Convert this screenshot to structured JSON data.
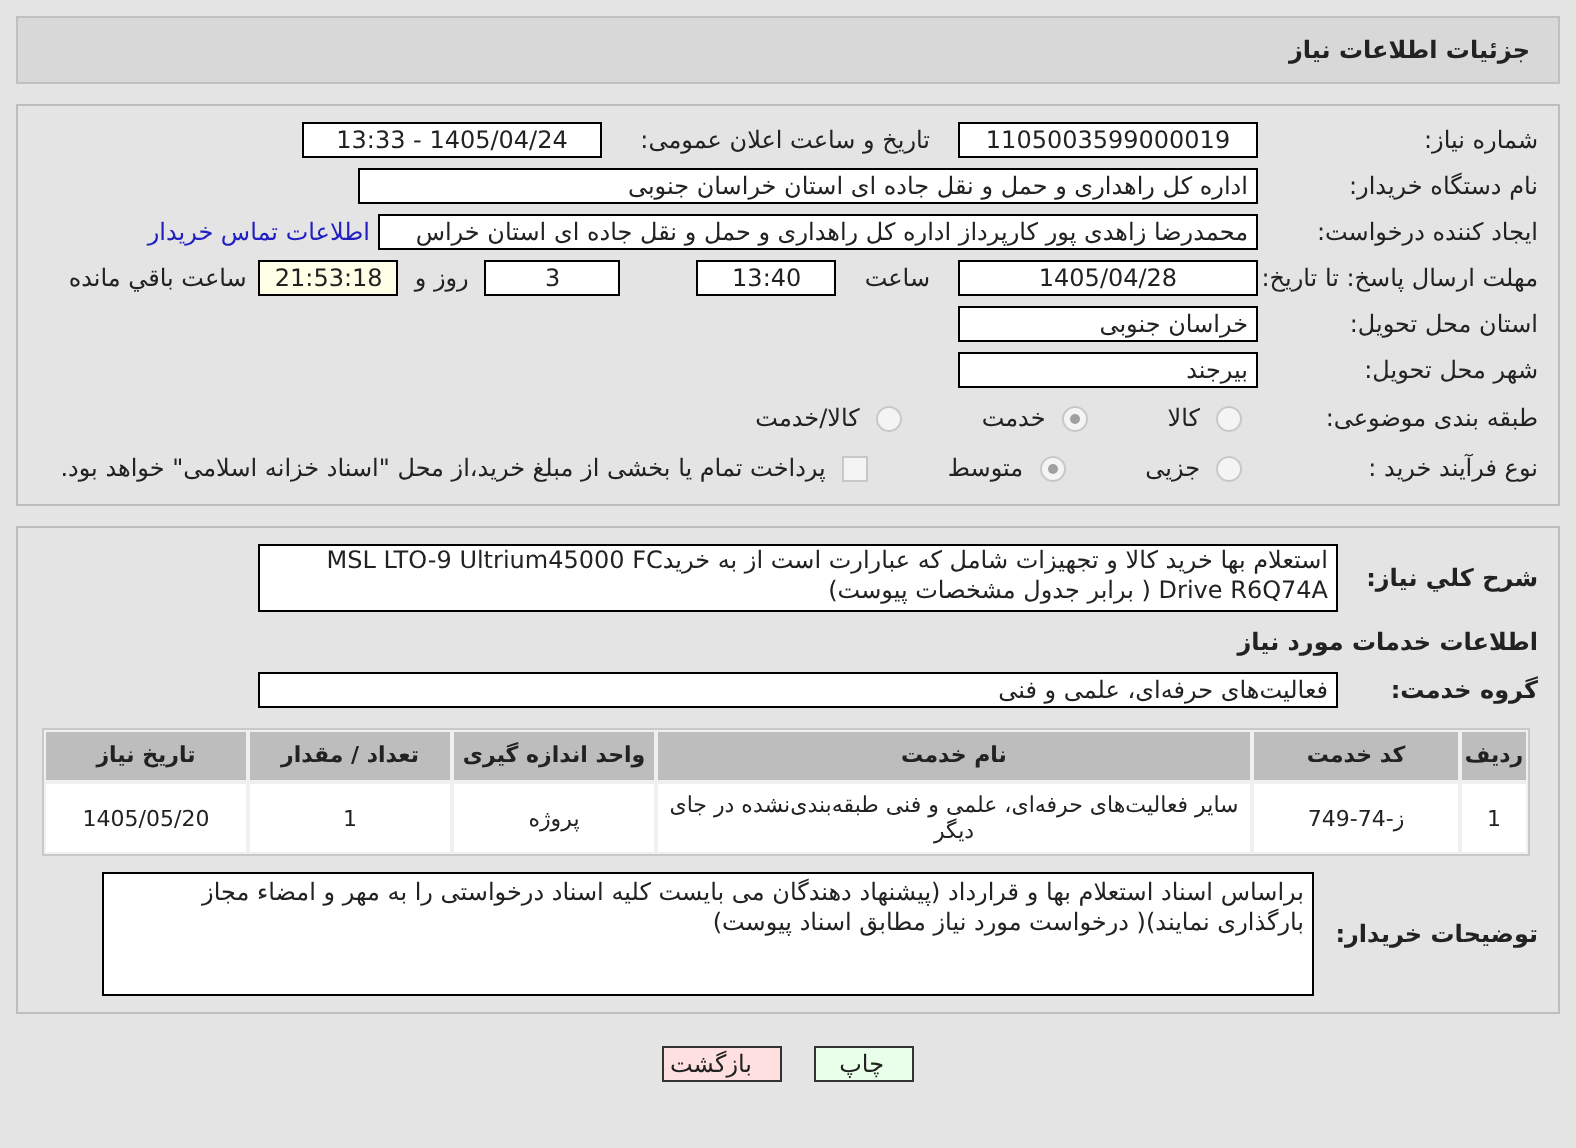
{
  "header": {
    "title": "جزئیات اطلاعات نیاز"
  },
  "fields": {
    "need_number": {
      "label": "شماره نیاز:",
      "value": "1105003599000019"
    },
    "announce": {
      "label": "تاریخ و ساعت اعلان عمومی:",
      "value": "1405/04/24 - 13:33"
    },
    "buyer": {
      "label": "نام دستگاه خریدار:",
      "value": "اداره کل راهداری و حمل و نقل جاده ای استان خراسان جنوبی"
    },
    "creator": {
      "label": "ایجاد کننده درخواست:",
      "value": "محمدرضا زاهدی پور کارپرداز اداره کل راهداری و حمل و نقل جاده ای استان خراس",
      "link": "اطلاعات تماس خریدار"
    },
    "deadline": {
      "label": "مهلت ارسال پاسخ: تا تاریخ:",
      "date": "1405/04/28",
      "time_label": "ساعت",
      "time": "13:40",
      "days": "3",
      "days_label": "روز و",
      "remaining": "21:53:18",
      "remaining_label": "ساعت باقي مانده"
    },
    "province": {
      "label": "استان محل تحویل:",
      "value": "خراسان جنوبی"
    },
    "city": {
      "label": "شهر محل تحویل:",
      "value": "بیرجند"
    },
    "category": {
      "label": "طبقه بندی موضوعی:",
      "options": [
        {
          "label": "کالا",
          "selected": false
        },
        {
          "label": "خدمت",
          "selected": true
        },
        {
          "label": "کالا/خدمت",
          "selected": false
        }
      ]
    },
    "process": {
      "label": "نوع فرآیند خرید :",
      "options": [
        {
          "label": "جزیی",
          "selected": false
        },
        {
          "label": "متوسط",
          "selected": true
        }
      ],
      "payment": {
        "checked": false,
        "text": "پرداخت تمام یا بخشی از مبلغ خرید،از محل \"اسناد خزانه اسلامی\" خواهد بود."
      }
    }
  },
  "details": {
    "description_label": "شرح کلي نیاز:",
    "description": "استعلام بها خرید کالا و تجهیزات شامل که عبارارت است از به  خریدMSL LTO-9 Ultrium45000 FC Drive R6Q74A ( برابر جدول مشخصات پیوست)",
    "services_heading": "اطلاعات خدمات مورد نیاز",
    "group_label": "گروه خدمت:",
    "group": "فعالیت‌های حرفه‌ای، علمی و فنی",
    "table": {
      "columns": [
        "ردیف",
        "کد خدمت",
        "نام خدمت",
        "واحد اندازه گیری",
        "تعداد / مقدار",
        "تاریخ نیاز"
      ],
      "rows": [
        [
          "1",
          "ز-74-749",
          "سایر فعالیت‌های حرفه‌ای، علمی و فنی طبقه‌بندی‌نشده در جای دیگر",
          "پروژه",
          "1",
          "1405/05/20"
        ]
      ]
    },
    "notes_label": "توضیحات خریدار:",
    "notes": "براساس اسناد استعلام بها و قرارداد (پیشنهاد دهندگان می بایست کلیه اسناد درخواستی را به مهر و امضاء مجاز بارگذاری نمایند)( درخواست مورد نیاز مطابق اسناد پیوست)"
  },
  "buttons": [
    {
      "label": "چاپ",
      "kind": "print"
    },
    {
      "label": "بازگشت",
      "kind": "back"
    }
  ]
}
